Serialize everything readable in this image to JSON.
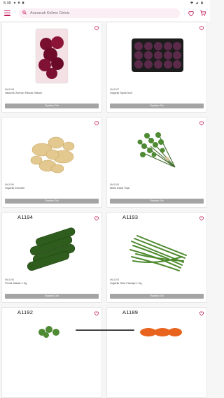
{
  "status": {
    "time": "5:39"
  },
  "search": {
    "placeholder": "Aranacak Kelime Giriniz"
  },
  "products": [
    {
      "code_small": "MA1198",
      "name": "Vakumlu Kırmızı Pancar Vakum",
      "code_big": "",
      "button": "Fiyatları Gör"
    },
    {
      "code_small": "MA1197",
      "name": "Organik Siyah İncir",
      "code_big": "",
      "button": "Fiyatları Gör"
    },
    {
      "code_small": "MA1196",
      "name": "Organik Zencefil",
      "code_big": "",
      "button": "Fiyatları Gör"
    },
    {
      "code_small": "MA1195",
      "name": "Minik Kekik Yeşil",
      "code_big": "",
      "button": "Fiyatları Gör"
    },
    {
      "code_small": "MA1194",
      "name": "Fındık Kabak 1 Kg",
      "code_big": "A1194",
      "button": "Fiyatları Gör"
    },
    {
      "code_small": "MA1193",
      "name": "Organik Taze Fasulye 1 Kg",
      "code_big": "A1193",
      "button": "Fiyatları Gör"
    },
    {
      "code_small": "",
      "name": "",
      "code_big": "A1192",
      "button": ""
    },
    {
      "code_small": "",
      "name": "",
      "code_big": "A1189",
      "button": ""
    }
  ]
}
